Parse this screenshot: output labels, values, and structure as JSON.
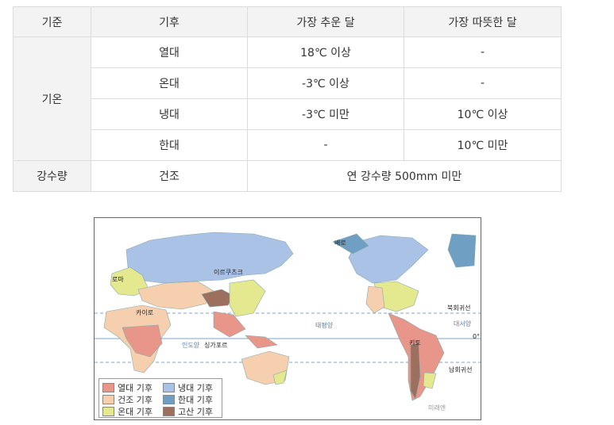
{
  "table": {
    "headers": [
      "기준",
      "기후",
      "가장 추운 달",
      "가장 따뜻한 달"
    ],
    "group_temp": "기온",
    "group_precip": "강수량",
    "rows": [
      {
        "climate": "열대",
        "cold": "18℃ 이상",
        "warm": "-"
      },
      {
        "climate": "온대",
        "cold": "-3℃ 이상",
        "warm": "-"
      },
      {
        "climate": "냉대",
        "cold": "-3℃ 미만",
        "warm": "10℃ 이상"
      },
      {
        "climate": "한대",
        "cold": "-",
        "warm": "10℃ 미만"
      }
    ],
    "dry": {
      "climate": "건조",
      "desc": "연 강수량 500mm 미만"
    }
  },
  "map": {
    "labels": {
      "irkutsk": "이르쿠츠크",
      "rome": "로마",
      "cairo": "카이로",
      "singapore": "싱가포르",
      "barrow": "배로",
      "tropic_cancer": "북회귀선",
      "tropic_capricorn": "남회귀선",
      "quito": "키토",
      "zero": "0°",
      "pacific": "태평양",
      "atlantic": "대서양",
      "indian": "인도양",
      "watermark": "미래엔"
    },
    "legend": [
      {
        "label": "열대 기후",
        "color": "#e8968a"
      },
      {
        "label": "냉대 기후",
        "color": "#a9c2e6"
      },
      {
        "label": "건조 기후",
        "color": "#f6cfae"
      },
      {
        "label": "한대 기후",
        "color": "#6f9fc2"
      },
      {
        "label": "온대 기후",
        "color": "#e4e88f"
      },
      {
        "label": "고산 기후",
        "color": "#9c6f5e"
      }
    ]
  }
}
